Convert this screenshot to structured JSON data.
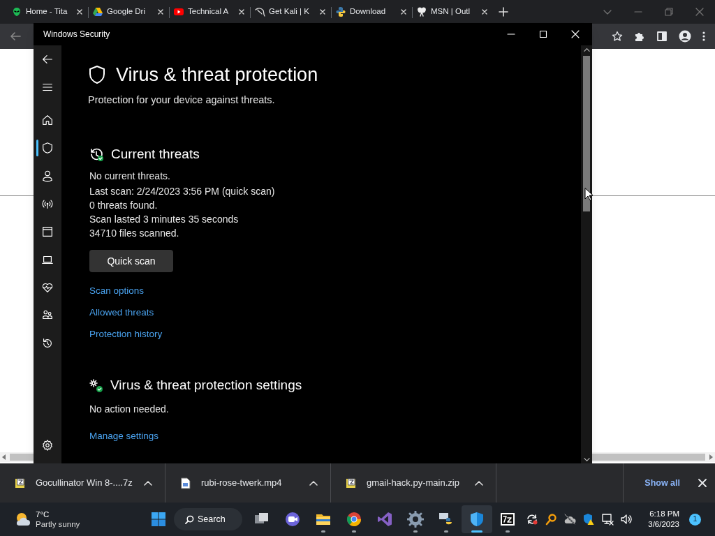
{
  "browser": {
    "tabs": [
      {
        "title": "Home - Tita"
      },
      {
        "title": "Google Dri"
      },
      {
        "title": "Technical A"
      },
      {
        "title": "Get Kali | K"
      },
      {
        "title": "Download"
      },
      {
        "title": "MSN | Outl"
      }
    ]
  },
  "security_window": {
    "title": "Windows Security",
    "nav": [
      {
        "kind": "back",
        "selected": false
      },
      {
        "kind": "menu",
        "selected": false
      },
      {
        "kind": "home",
        "selected": false
      },
      {
        "kind": "shield",
        "selected": true
      },
      {
        "kind": "person",
        "selected": false
      },
      {
        "kind": "wireless",
        "selected": false
      },
      {
        "kind": "browser",
        "selected": false
      },
      {
        "kind": "laptop",
        "selected": false
      },
      {
        "kind": "heart",
        "selected": false
      },
      {
        "kind": "family",
        "selected": false
      },
      {
        "kind": "history",
        "selected": false
      },
      {
        "kind": "settings",
        "selected": false
      }
    ],
    "heading": "Virus & threat protection",
    "subtitle": "Protection for your device against threats.",
    "current_threats": {
      "title": "Current threats",
      "status": "No current threats.",
      "details": [
        "Last scan: 2/24/2023 3:56 PM (quick scan)",
        "0 threats found.",
        "Scan lasted 3 minutes 35 seconds",
        "34710 files scanned."
      ],
      "button": "Quick scan",
      "links": [
        "Scan options",
        "Allowed threats",
        "Protection history"
      ]
    },
    "settings": {
      "title": "Virus & threat protection settings",
      "status": "No action needed.",
      "link": "Manage settings"
    }
  },
  "downloads": {
    "items": [
      {
        "name": "Gocullinator Win 8-....7z",
        "kind": "archive"
      },
      {
        "name": "rubi-rose-twerk.mp4",
        "kind": "video"
      },
      {
        "name": "gmail-hack.py-main.zip",
        "kind": "archive"
      }
    ],
    "show_all": "Show all"
  },
  "taskbar": {
    "weather": {
      "temperature": "7°C",
      "condition": "Partly sunny"
    },
    "search": "Search",
    "apps": [
      {
        "kind": "taskview",
        "running": false,
        "active": false
      },
      {
        "kind": "chat",
        "running": false,
        "active": false
      },
      {
        "kind": "explorer",
        "running": true,
        "active": false
      },
      {
        "kind": "chrome",
        "running": true,
        "active": false
      },
      {
        "kind": "vs",
        "running": false,
        "active": false
      },
      {
        "kind": "settings",
        "running": true,
        "active": false
      },
      {
        "kind": "python",
        "running": true,
        "active": false
      },
      {
        "kind": "security",
        "running": true,
        "active": true
      },
      {
        "kind": "archiver",
        "running": true,
        "active": false
      }
    ],
    "time": "6:18 PM",
    "date": "3/6/2023",
    "notifications": "1"
  }
}
